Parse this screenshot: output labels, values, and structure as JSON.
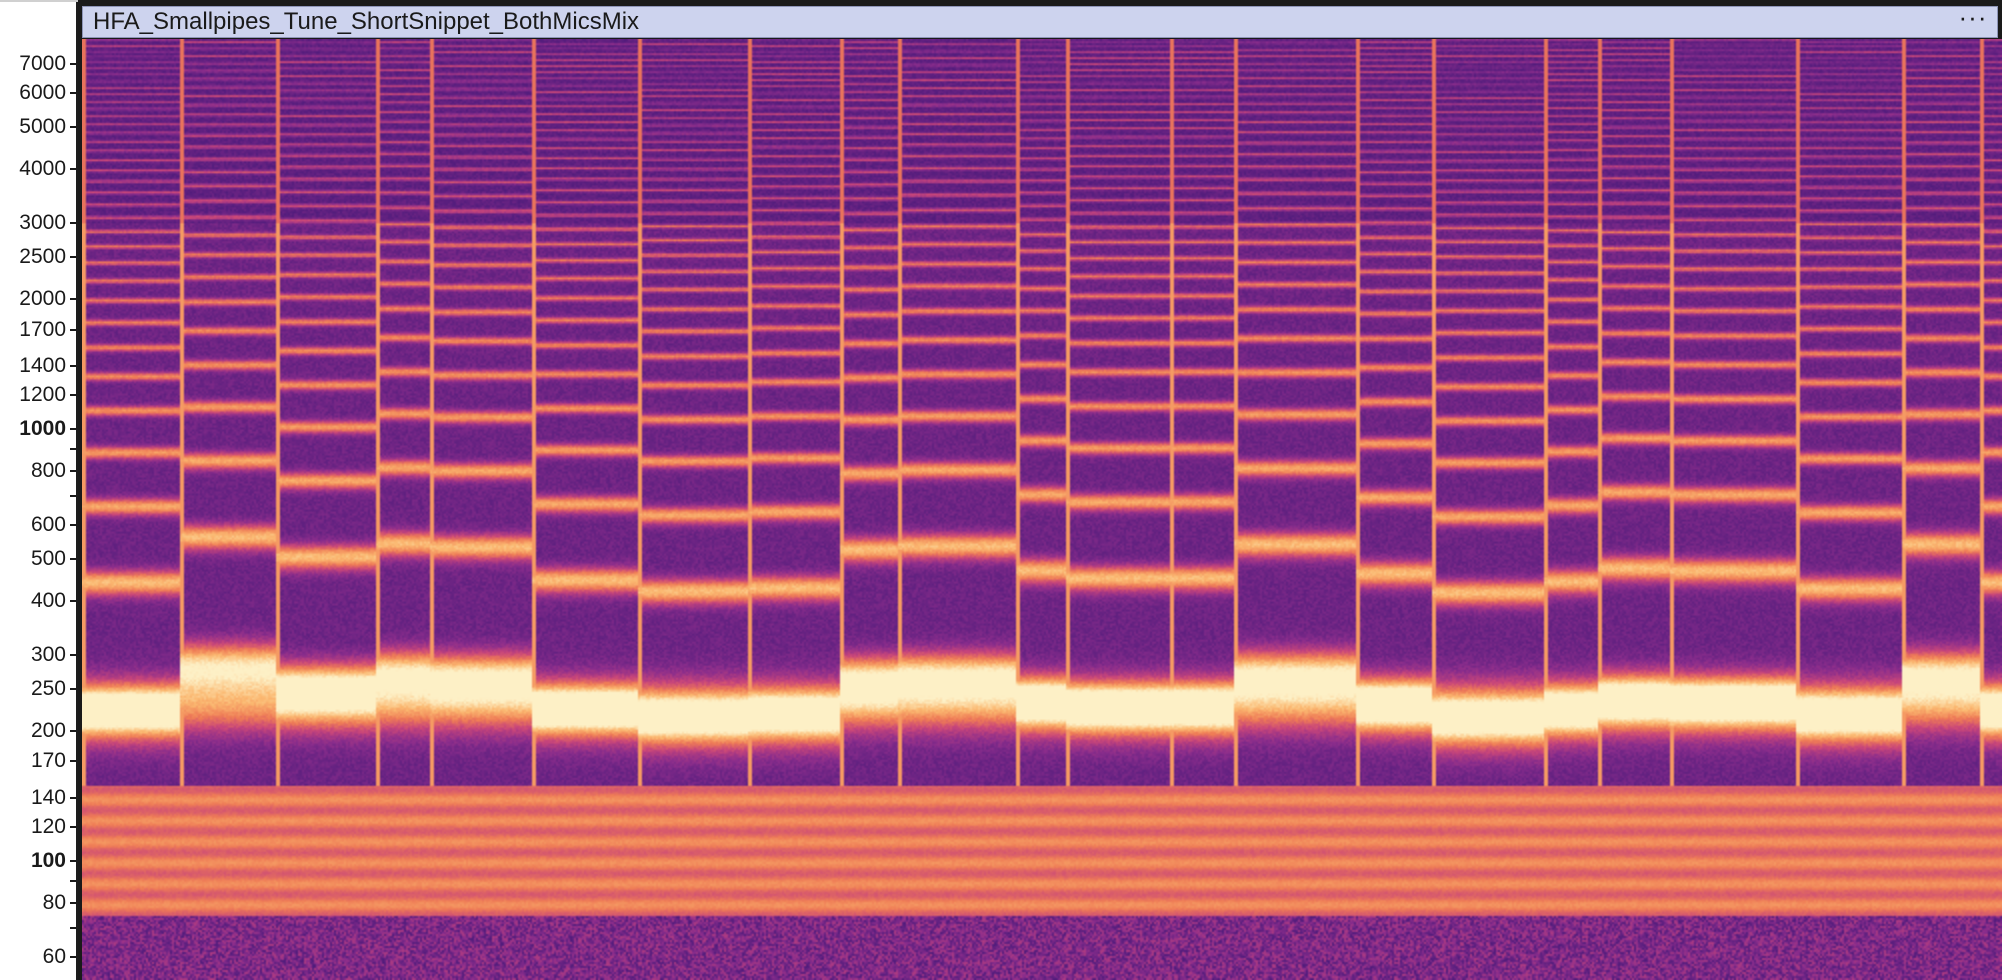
{
  "track": {
    "title": "HFA_Smallpipes_Tune_ShortSnippet_BothMicsMix",
    "menu_label": "···"
  },
  "frequency_ruler": {
    "unit": "Hz",
    "scale": "log",
    "range_hz": [
      53,
      8000
    ],
    "ticks": [
      {
        "label": "7000",
        "value": 7000,
        "bold": false
      },
      {
        "label": "6000",
        "value": 6000,
        "bold": false
      },
      {
        "label": "5000",
        "value": 5000,
        "bold": false
      },
      {
        "label": "4000",
        "value": 4000,
        "bold": false
      },
      {
        "label": "3000",
        "value": 3000,
        "bold": false
      },
      {
        "label": "2500",
        "value": 2500,
        "bold": false
      },
      {
        "label": "2000",
        "value": 2000,
        "bold": false
      },
      {
        "label": "1700",
        "value": 1700,
        "bold": false
      },
      {
        "label": "1400",
        "value": 1400,
        "bold": false
      },
      {
        "label": "1200",
        "value": 1200,
        "bold": false
      },
      {
        "label": "1000",
        "value": 1000,
        "bold": true
      },
      {
        "label": "800",
        "value": 800,
        "bold": false
      },
      {
        "label": "600",
        "value": 600,
        "bold": false
      },
      {
        "label": "500",
        "value": 500,
        "bold": false
      },
      {
        "label": "400",
        "value": 400,
        "bold": false
      },
      {
        "label": "300",
        "value": 300,
        "bold": false
      },
      {
        "label": "250",
        "value": 250,
        "bold": false
      },
      {
        "label": "200",
        "value": 200,
        "bold": false
      },
      {
        "label": "170",
        "value": 170,
        "bold": false
      },
      {
        "label": "140",
        "value": 140,
        "bold": false
      },
      {
        "label": "120",
        "value": 120,
        "bold": false
      },
      {
        "label": "100",
        "value": 100,
        "bold": true
      },
      {
        "label": "80",
        "value": 80,
        "bold": false
      },
      {
        "label": "60",
        "value": 60,
        "bold": false
      }
    ],
    "minor_ticks": [
      900,
      700,
      90,
      70
    ]
  },
  "colors": {
    "header_bg": "#cdd3ee",
    "colormap": [
      "#1b0c3d",
      "#4a1a7a",
      "#8a2d8c",
      "#c9467a",
      "#ef7c56",
      "#fbb870",
      "#fdf0c6"
    ]
  }
}
